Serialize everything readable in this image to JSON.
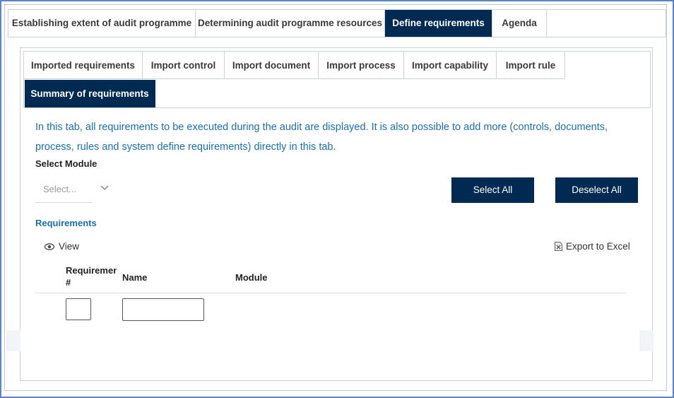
{
  "top_tabs": [
    {
      "label": "Establishing extent of audit programme",
      "active": false
    },
    {
      "label": "Determining audit programme resources",
      "active": false
    },
    {
      "label": "Define requirements",
      "active": true
    },
    {
      "label": "Agenda",
      "active": false
    }
  ],
  "sub_tabs": [
    {
      "label": "Imported requirements",
      "active": false
    },
    {
      "label": "Import control",
      "active": false
    },
    {
      "label": "Import document",
      "active": false
    },
    {
      "label": "Import process",
      "active": false
    },
    {
      "label": "Import capability",
      "active": false
    },
    {
      "label": "Import rule",
      "active": false
    },
    {
      "label": "Summary of requirements",
      "active": true
    }
  ],
  "description": "In this tab, all requirements to be executed during the audit are displayed. It is also possible to add more (controls, documents, process, rules and system define requirements) directly in this tab.",
  "select_module": {
    "label": "Select Module",
    "placeholder": "Select..."
  },
  "buttons": {
    "select_all": "Select All",
    "deselect_all": "Deselect All"
  },
  "requirements": {
    "heading": "Requirements",
    "view_label": "View",
    "export_label": "Export to Excel",
    "columns": [
      "Requirement #",
      "Name",
      "Module"
    ]
  },
  "colors": {
    "active_tab": "#002a52",
    "link_blue": "#1a6fb0",
    "frame": "#5b86c4"
  }
}
